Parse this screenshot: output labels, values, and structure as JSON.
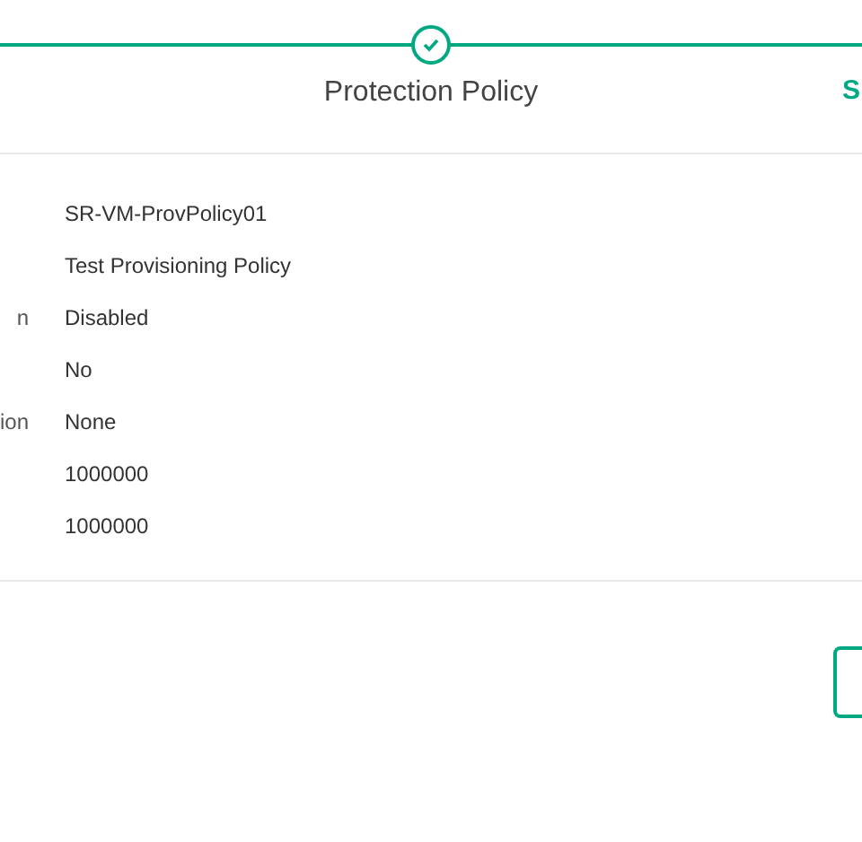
{
  "stepper": {
    "steps": [
      {
        "label": "Protection Policy",
        "completed": true,
        "selected": false
      },
      {
        "label": "S",
        "completed": false,
        "selected": true
      }
    ]
  },
  "details": [
    {
      "value": "SR-VM-ProvPolicy01"
    },
    {
      "value": "Test Provisioning Policy"
    },
    {
      "label": "n",
      "value": "Disabled"
    },
    {
      "value": "No"
    },
    {
      "label": "ion",
      "value": "None"
    },
    {
      "value": "1000000"
    },
    {
      "value": "1000000"
    }
  ]
}
